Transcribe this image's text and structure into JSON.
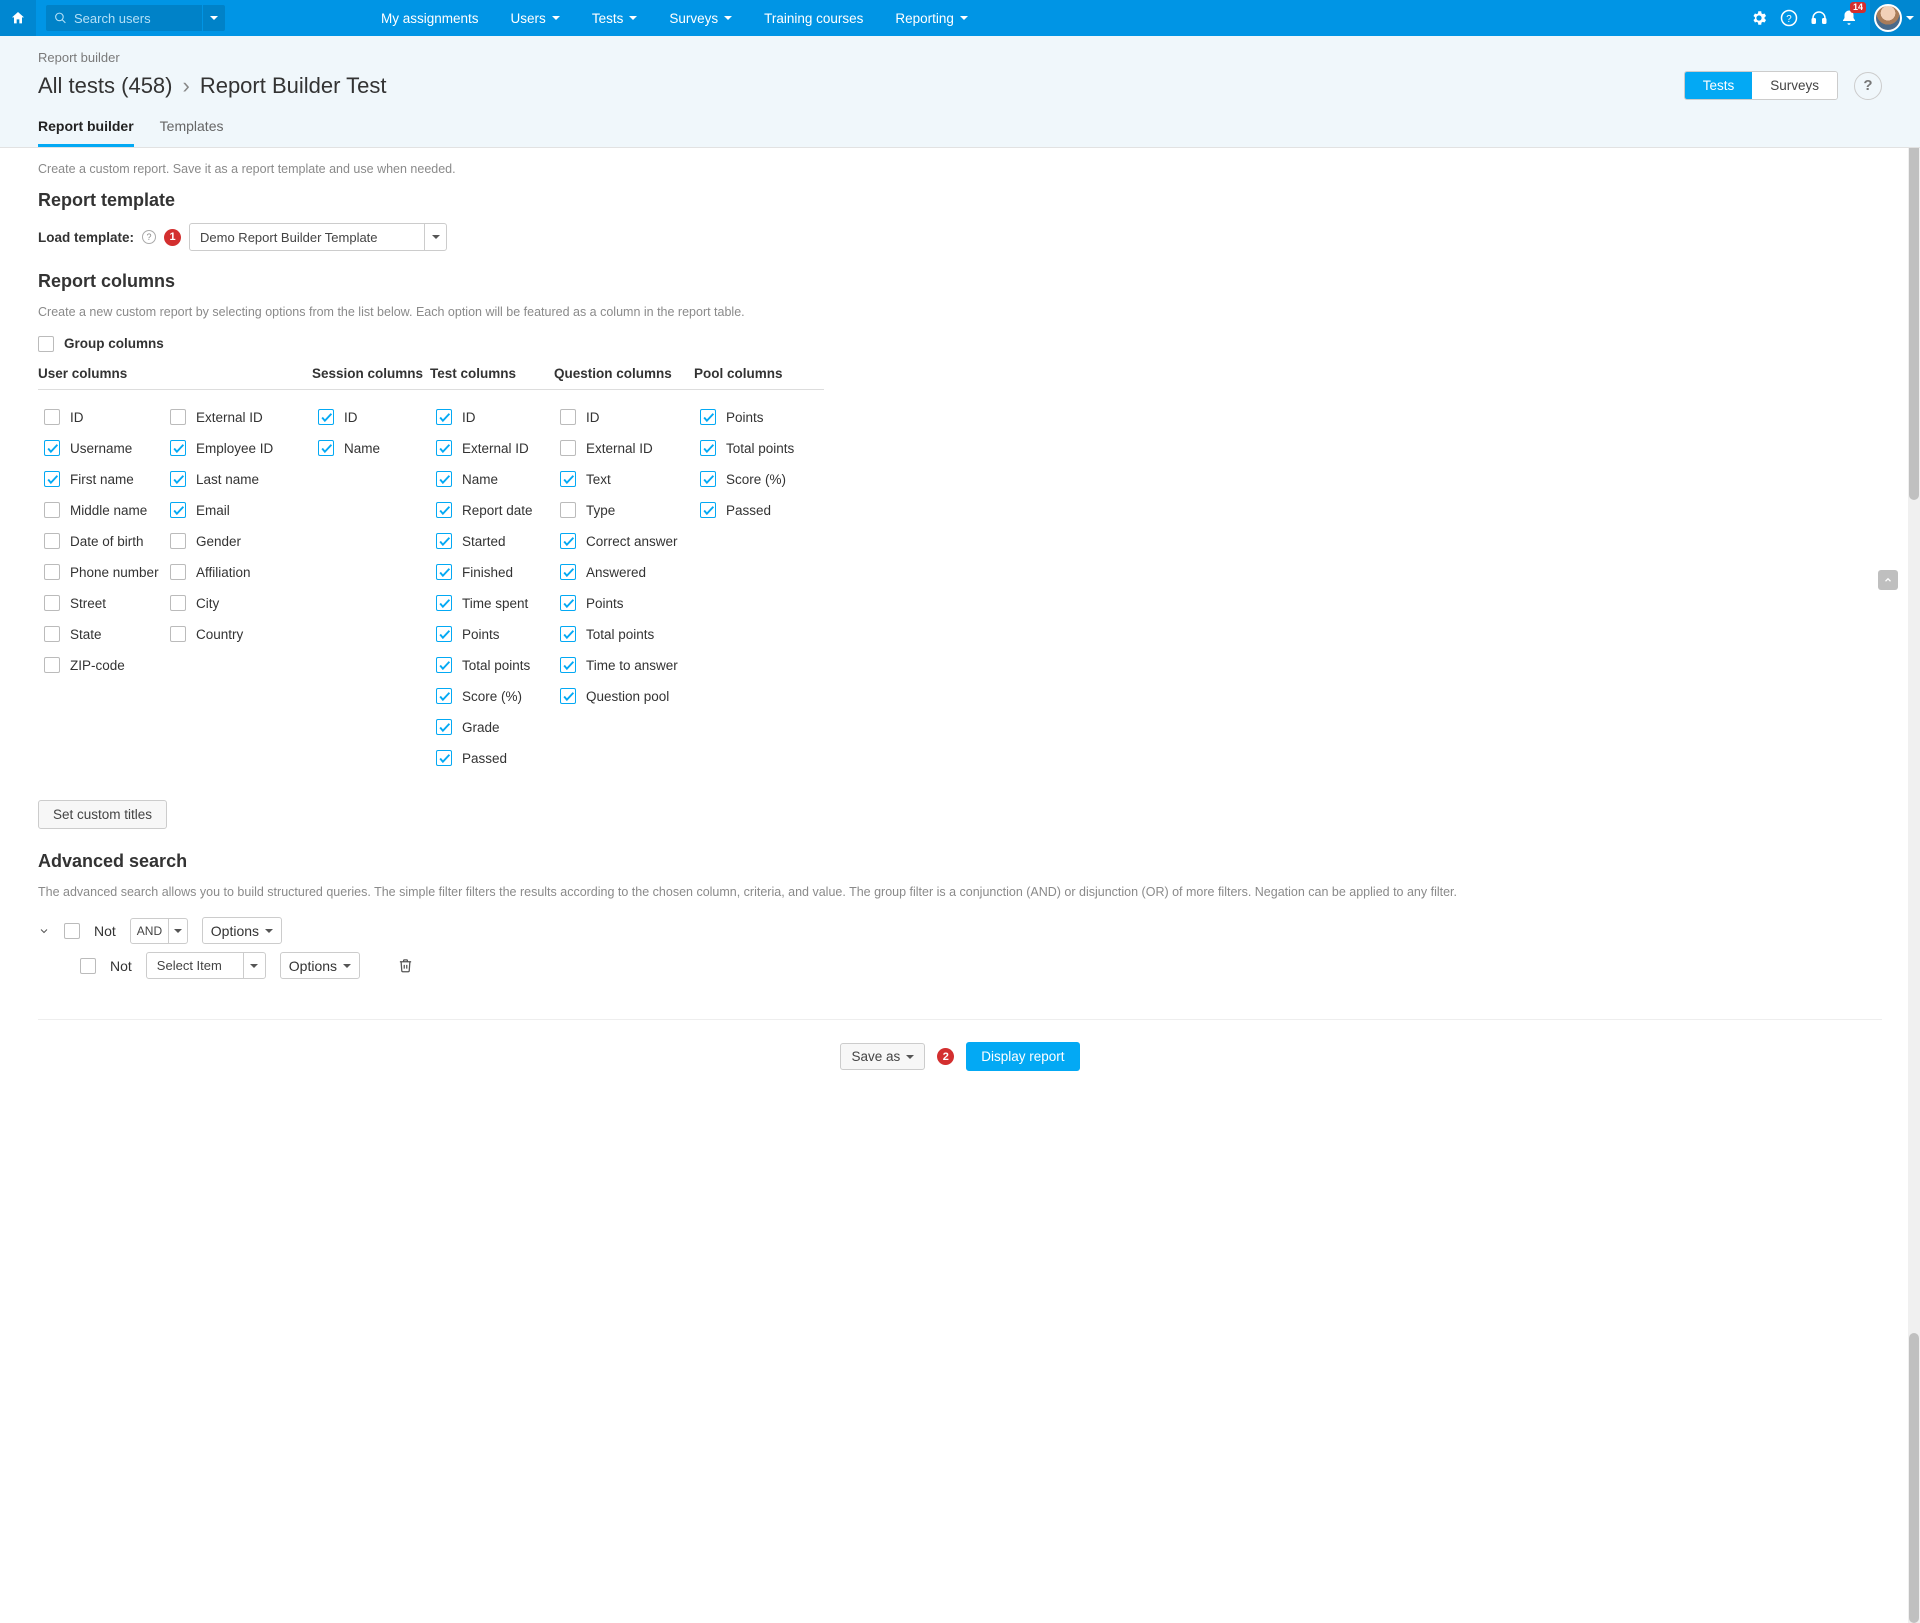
{
  "topbar": {
    "search_placeholder": "Search users",
    "menu": [
      "My assignments",
      "Users",
      "Tests",
      "Surveys",
      "Training courses",
      "Reporting"
    ],
    "menu_has_caret": [
      false,
      true,
      true,
      true,
      false,
      true
    ],
    "notification_count": "14"
  },
  "header": {
    "breadcrumb": "Report builder",
    "title_left": "All tests (458)",
    "title_right": "Report Builder Test",
    "toggle": {
      "tests": "Tests",
      "surveys": "Surveys"
    },
    "tabs": {
      "builder": "Report builder",
      "templates": "Templates"
    }
  },
  "body": {
    "intro": "Create a custom report. Save it as a report template and use when needed.",
    "template_heading": "Report template",
    "load_label": "Load template:",
    "badge1": "1",
    "template_value": "Demo Report Builder Template",
    "columns_heading": "Report columns",
    "columns_hint": "Create a new custom report by selecting options from the list below. Each option will be featured as a column in the report table.",
    "group_columns": "Group columns",
    "col_titles": {
      "user": "User columns",
      "session": "Session columns",
      "test": "Test columns",
      "question": "Question columns",
      "pool": "Pool columns"
    },
    "user_columns_left": [
      {
        "label": "ID",
        "checked": false
      },
      {
        "label": "Username",
        "checked": true
      },
      {
        "label": "First name",
        "checked": true
      },
      {
        "label": "Middle name",
        "checked": false
      },
      {
        "label": "Date of birth",
        "checked": false
      },
      {
        "label": "Phone number",
        "checked": false
      },
      {
        "label": "Street",
        "checked": false
      },
      {
        "label": "State",
        "checked": false
      },
      {
        "label": "ZIP-code",
        "checked": false
      }
    ],
    "user_columns_right": [
      {
        "label": "External ID",
        "checked": false
      },
      {
        "label": "Employee ID",
        "checked": true
      },
      {
        "label": "Last name",
        "checked": true
      },
      {
        "label": "Email",
        "checked": true
      },
      {
        "label": "Gender",
        "checked": false
      },
      {
        "label": "Affiliation",
        "checked": false
      },
      {
        "label": "City",
        "checked": false
      },
      {
        "label": "Country",
        "checked": false
      }
    ],
    "session_columns": [
      {
        "label": "ID",
        "checked": true
      },
      {
        "label": "Name",
        "checked": true
      }
    ],
    "test_columns": [
      {
        "label": "ID",
        "checked": true
      },
      {
        "label": "External ID",
        "checked": true
      },
      {
        "label": "Name",
        "checked": true
      },
      {
        "label": "Report date",
        "checked": true
      },
      {
        "label": "Started",
        "checked": true
      },
      {
        "label": "Finished",
        "checked": true
      },
      {
        "label": "Time spent",
        "checked": true
      },
      {
        "label": "Points",
        "checked": true
      },
      {
        "label": "Total points",
        "checked": true
      },
      {
        "label": "Score (%)",
        "checked": true
      },
      {
        "label": "Grade",
        "checked": true
      },
      {
        "label": "Passed",
        "checked": true
      }
    ],
    "question_columns": [
      {
        "label": "ID",
        "checked": false
      },
      {
        "label": "External ID",
        "checked": false
      },
      {
        "label": "Text",
        "checked": true
      },
      {
        "label": "Type",
        "checked": false
      },
      {
        "label": "Correct answer",
        "checked": true
      },
      {
        "label": "Answered",
        "checked": true
      },
      {
        "label": "Points",
        "checked": true
      },
      {
        "label": "Total points",
        "checked": true
      },
      {
        "label": "Time to answer",
        "checked": true
      },
      {
        "label": "Question pool",
        "checked": true
      }
    ],
    "pool_columns": [
      {
        "label": "Points",
        "checked": true
      },
      {
        "label": "Total points",
        "checked": true
      },
      {
        "label": "Score (%)",
        "checked": true
      },
      {
        "label": "Passed",
        "checked": true
      }
    ],
    "set_titles_btn": "Set custom titles",
    "adv_heading": "Advanced search",
    "adv_hint": "The advanced search allows you to build structured queries. The simple filter filters the results according to the chosen column, criteria, and value. The group filter is a conjunction (AND) or disjunction (OR) of more filters. Negation can be applied to any filter.",
    "not_label": "Not",
    "and_label": "AND",
    "options_label": "Options",
    "select_item": "Select Item",
    "save_as": "Save as",
    "badge2": "2",
    "display_report": "Display report"
  }
}
